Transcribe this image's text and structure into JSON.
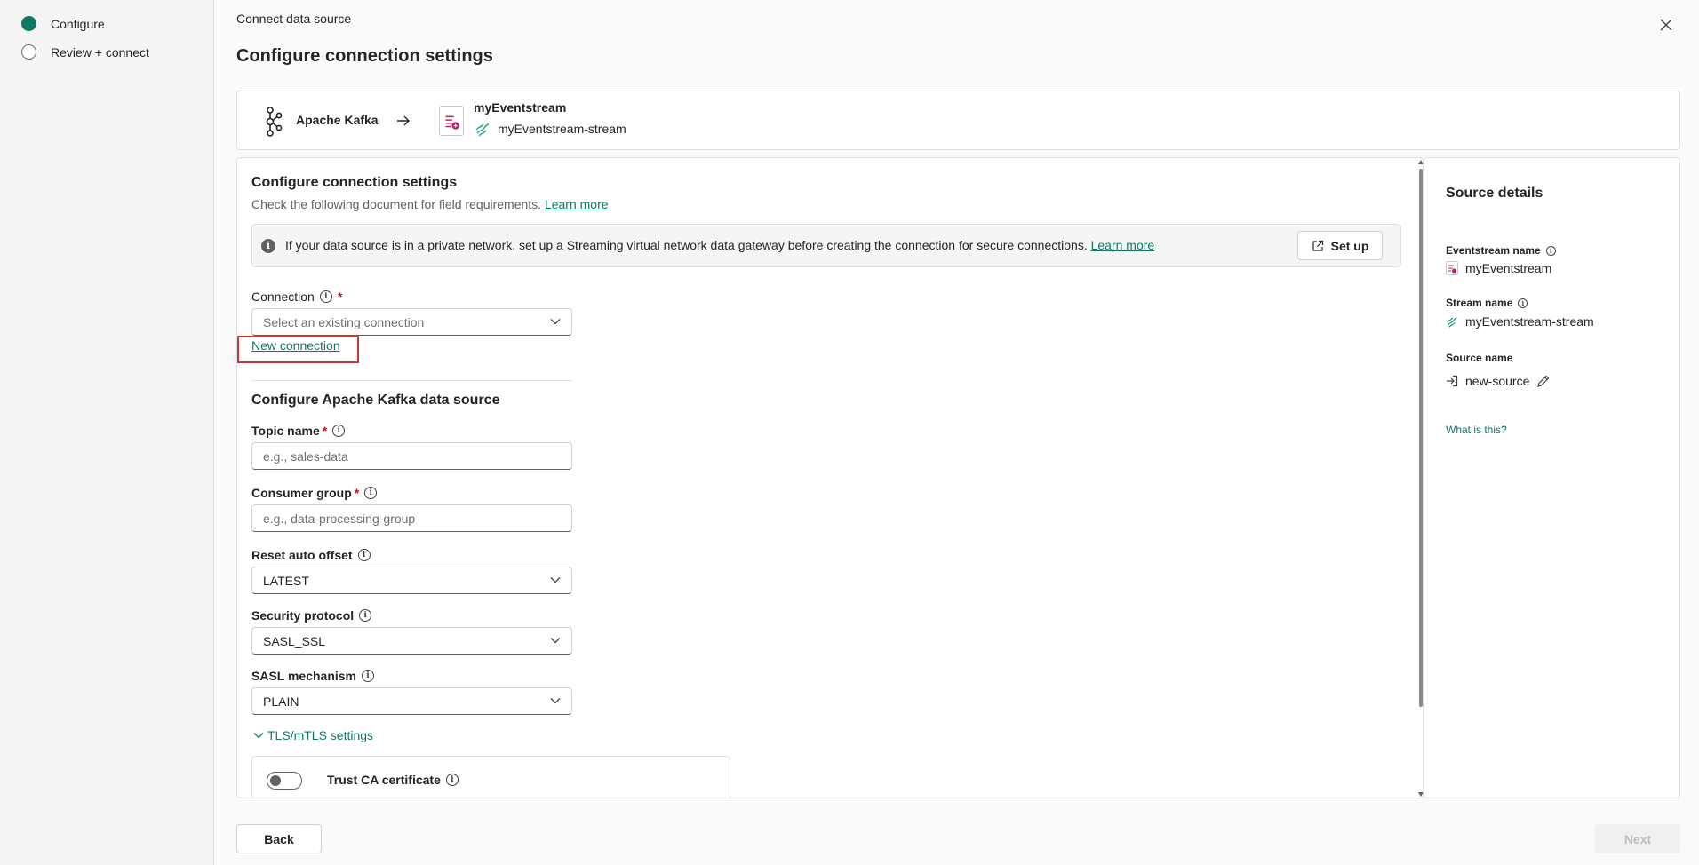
{
  "steps": [
    {
      "label": "Configure",
      "active": true
    },
    {
      "label": "Review + connect",
      "active": false
    }
  ],
  "header": {
    "breadcrumb": "Connect data source",
    "title": "Configure connection settings"
  },
  "source_card": {
    "source_name": "Apache Kafka",
    "destination_name": "myEventstream",
    "stream_name": "myEventstream-stream"
  },
  "form": {
    "section_title": "Configure connection settings",
    "hint": "Check the following document for field requirements.",
    "hint_link": "Learn more",
    "info_text": "If your data source is in a private network, set up a Streaming virtual network data gateway before creating the connection for secure connections.",
    "info_link": "Learn more",
    "setup_label": "Set up",
    "connection_label": "Connection",
    "connection_placeholder": "Select an existing connection",
    "new_connection_label": "New connection",
    "kafka_section_title": "Configure Apache Kafka data source",
    "topic_label": "Topic name",
    "topic_placeholder": "e.g., sales-data",
    "consumer_label": "Consumer group",
    "consumer_placeholder": "e.g., data-processing-group",
    "offset_label": "Reset auto offset",
    "offset_value": "LATEST",
    "protocol_label": "Security protocol",
    "protocol_value": "SASL_SSL",
    "sasl_label": "SASL mechanism",
    "sasl_value": "PLAIN",
    "tls_label": "TLS/mTLS settings",
    "trust_label": "Trust CA certificate",
    "required_mark": "*",
    "info_glyph": "i"
  },
  "details": {
    "title": "Source details",
    "eventstream_label": "Eventstream name",
    "eventstream_value": "myEventstream",
    "stream_label": "Stream name",
    "stream_value": "myEventstream-stream",
    "source_label": "Source name",
    "source_value": "new-source",
    "what_link": "What is this?"
  },
  "footer": {
    "back_label": "Back",
    "next_label": "Next"
  },
  "colors": {
    "accent": "#117865",
    "highlight": "#d13438",
    "required": "#c50f1f"
  },
  "icons": {
    "close": "close-icon",
    "kafka": "kafka-icon",
    "arrow": "arrow-right-icon",
    "eventstream": "eventstream-icon",
    "stream": "stream-icon",
    "info": "info-icon",
    "external": "external-link-icon",
    "chevron": "chevron-down-icon",
    "edit": "pencil-icon",
    "source": "sign-in-icon"
  }
}
